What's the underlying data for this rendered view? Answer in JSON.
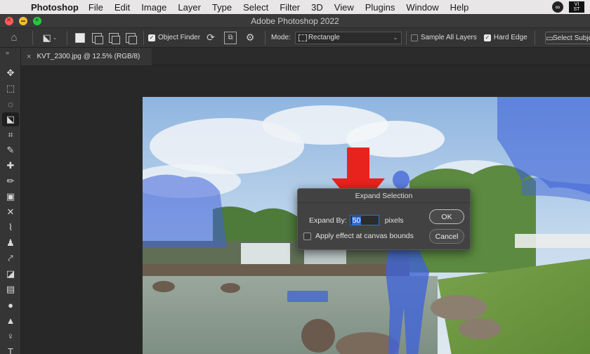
{
  "menubar": {
    "app_name": "Photoshop",
    "menus": [
      "File",
      "Edit",
      "Image",
      "Layer",
      "Type",
      "Select",
      "Filter",
      "3D",
      "View",
      "Plugins",
      "Window",
      "Help"
    ],
    "badge_text": "VI\nST"
  },
  "window": {
    "title": "Adobe Photoshop 2022"
  },
  "options_bar": {
    "object_finder_label": "Object Finder",
    "object_finder_checked": true,
    "mode_label": "Mode:",
    "mode_value": "Rectangle",
    "sample_all_layers_label": "Sample All Layers",
    "sample_all_layers_checked": false,
    "hard_edge_label": "Hard Edge",
    "hard_edge_checked": true,
    "select_subject_label": "Select Subjec"
  },
  "document_tab": {
    "close_glyph": "×",
    "name": "KVT_2300.jpg @ 12.5% (RGB/8)"
  },
  "toolbar": {
    "collapse_glyph": "»",
    "tools": [
      {
        "name": "move-tool",
        "glyph": "✥"
      },
      {
        "name": "marquee-tool",
        "glyph": "⬚"
      },
      {
        "name": "lasso-tool",
        "glyph": "◌"
      },
      {
        "name": "object-selection-tool",
        "glyph": "⬕",
        "active": true
      },
      {
        "name": "crop-tool",
        "glyph": "⌗"
      },
      {
        "name": "eyedropper-tool",
        "glyph": "✎"
      },
      {
        "name": "healing-brush-tool",
        "glyph": "✚"
      },
      {
        "name": "brush-tool",
        "glyph": "✏"
      },
      {
        "name": "stamp-tool",
        "glyph": "▣"
      },
      {
        "name": "history-brush-tool",
        "glyph": "✕"
      },
      {
        "name": "eraser-tool",
        "glyph": "⌇"
      },
      {
        "name": "clone-stamp-tool",
        "glyph": "♟"
      },
      {
        "name": "art-history-tool",
        "glyph": "⤤"
      },
      {
        "name": "eraser-tool-2",
        "glyph": "◪"
      },
      {
        "name": "gradient-tool",
        "glyph": "▤"
      },
      {
        "name": "blur-tool",
        "glyph": "●"
      },
      {
        "name": "dodge-tool",
        "glyph": "▲"
      },
      {
        "name": "pen-tool",
        "glyph": "♀"
      },
      {
        "name": "type-tool",
        "glyph": "T"
      }
    ]
  },
  "dialog": {
    "title": "Expand Selection",
    "expand_by_label": "Expand By:",
    "expand_by_value": "50",
    "unit_label": "pixels",
    "apply_bounds_label": "Apply effect at canvas bounds",
    "apply_bounds_checked": false,
    "ok_label": "OK",
    "cancel_label": "Cancel"
  },
  "colors": {
    "selection_overlay": "#3f63d8",
    "arrow": "#e8231e",
    "accent": "#2d6fd6"
  }
}
